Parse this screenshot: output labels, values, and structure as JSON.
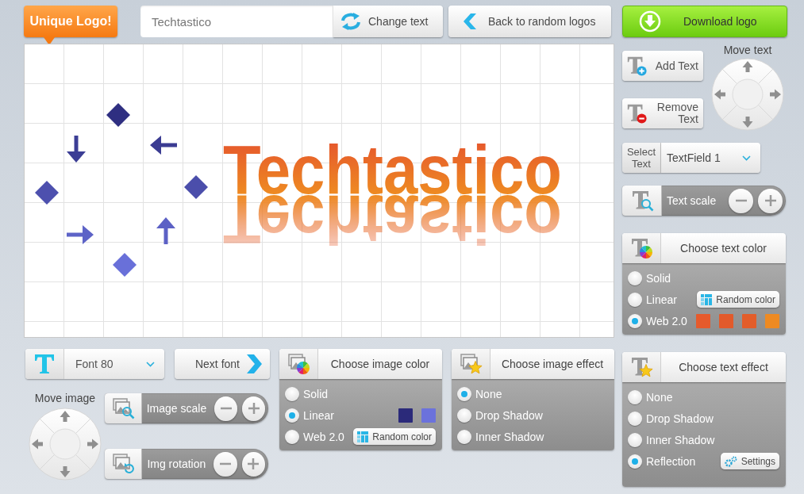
{
  "header": {
    "badge": "Unique Logo!",
    "text_field": {
      "value": "Techtastico"
    },
    "change_button": "Change text",
    "back_button": "Back to random logos",
    "download_button": "Download logo"
  },
  "canvas": {
    "logo_text": "Techtastico"
  },
  "text_tools": {
    "add_button": "Add Text",
    "remove_button": "Remove Text",
    "move_label": "Move text",
    "select_label": "Select Text",
    "select_value": "TextField 1",
    "scale_label": "Text scale"
  },
  "text_color": {
    "title": "Choose text color",
    "options": [
      {
        "label": "Solid",
        "selected": false
      },
      {
        "label": "Linear",
        "selected": false,
        "button": {
          "label": "Random color",
          "kind": "random"
        }
      },
      {
        "label": "Web 2.0",
        "selected": true,
        "swatches": [
          {
            "color": "#e65a2c"
          },
          {
            "color": "#e25a2b"
          },
          {
            "color": "#e35d2a"
          },
          {
            "color": "#ee8a22"
          }
        ]
      }
    ]
  },
  "font": {
    "value": "Font 80",
    "next_button": "Next font"
  },
  "image_tools": {
    "move_label": "Move image",
    "scale_label": "Image scale",
    "rotation_label": "Img rotation"
  },
  "image_color": {
    "title": "Choose image color",
    "options": [
      {
        "label": "Solid",
        "selected": false
      },
      {
        "label": "Linear",
        "selected": true,
        "swatches": [
          {
            "color": "#2b2a7a"
          },
          {
            "color": "#6b72dc"
          }
        ]
      },
      {
        "label": "Web 2.0",
        "selected": false,
        "button": {
          "label": "Random color",
          "kind": "random"
        }
      }
    ]
  },
  "image_effect": {
    "title": "Choose image effect",
    "options": [
      {
        "label": "None",
        "selected": true
      },
      {
        "label": "Drop Shadow",
        "selected": false
      },
      {
        "label": "Inner Shadow",
        "selected": false
      }
    ]
  },
  "text_effect": {
    "title": "Choose text effect",
    "options": [
      {
        "label": "None",
        "selected": false
      },
      {
        "label": "Drop Shadow",
        "selected": false
      },
      {
        "label": "Inner Shadow",
        "selected": false
      },
      {
        "label": "Reflection",
        "selected": true,
        "button": {
          "label": "Settings",
          "kind": "settings"
        }
      }
    ]
  }
}
